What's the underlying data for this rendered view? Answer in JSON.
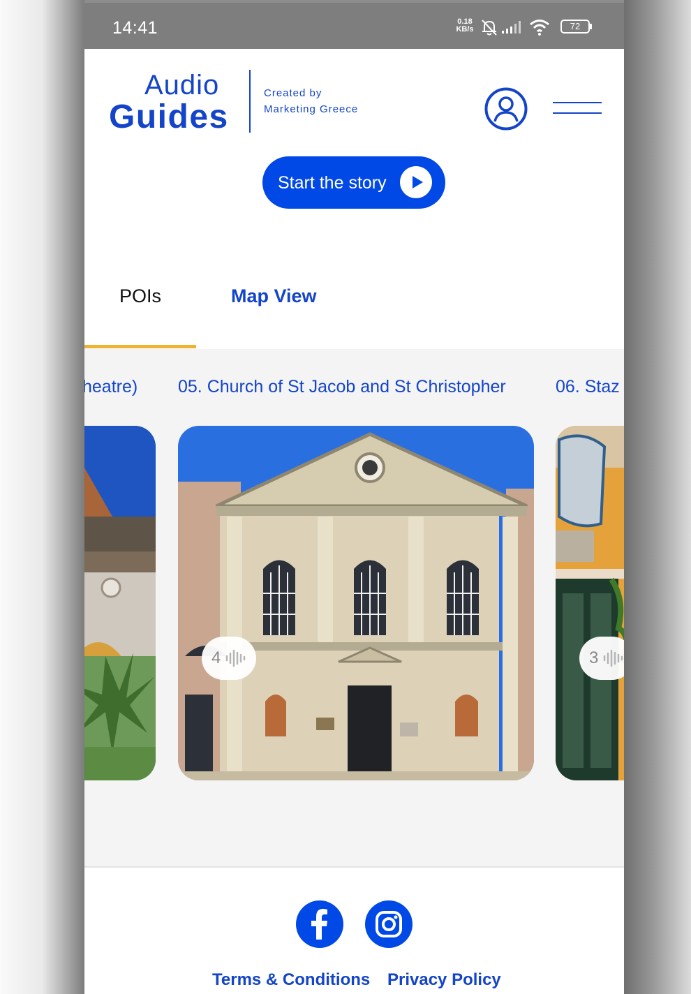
{
  "status_bar": {
    "time": "14:41",
    "speed_value": "0.18",
    "speed_unit": "KB/s",
    "battery": "72",
    "icons": [
      "bell-off-icon",
      "signal-icon",
      "wifi-icon",
      "battery-icon"
    ]
  },
  "header": {
    "logo_line1": "Audio",
    "logo_line2": "Guides",
    "created_by_line1": "Created by",
    "created_by_line2": "Marketing Greece",
    "icons": [
      "user-icon",
      "menu-icon"
    ]
  },
  "start_button": {
    "label": "Start the story",
    "icon": "play-icon"
  },
  "tabs": [
    {
      "label": "POIs",
      "active": true
    },
    {
      "label": "Map View",
      "active": false
    }
  ],
  "pois": [
    {
      "title": "heatre)",
      "image": "theatre-building-photo"
    },
    {
      "title": "05. Church of St Jacob and St Christopher",
      "image": "church-facade-photo",
      "audio_count": "4"
    },
    {
      "title": "06. Staz",
      "image": "shopfront-photo",
      "audio_count": "3"
    }
  ],
  "footer": {
    "social": [
      "facebook-icon",
      "instagram-icon"
    ],
    "terms": "Terms & Conditions",
    "privacy": "Privacy Policy"
  },
  "colors": {
    "brand_blue": "#1344c9",
    "button_blue": "#0049e6",
    "tab_indicator": "#f0b232",
    "status_bar": "#7e7e7e"
  }
}
